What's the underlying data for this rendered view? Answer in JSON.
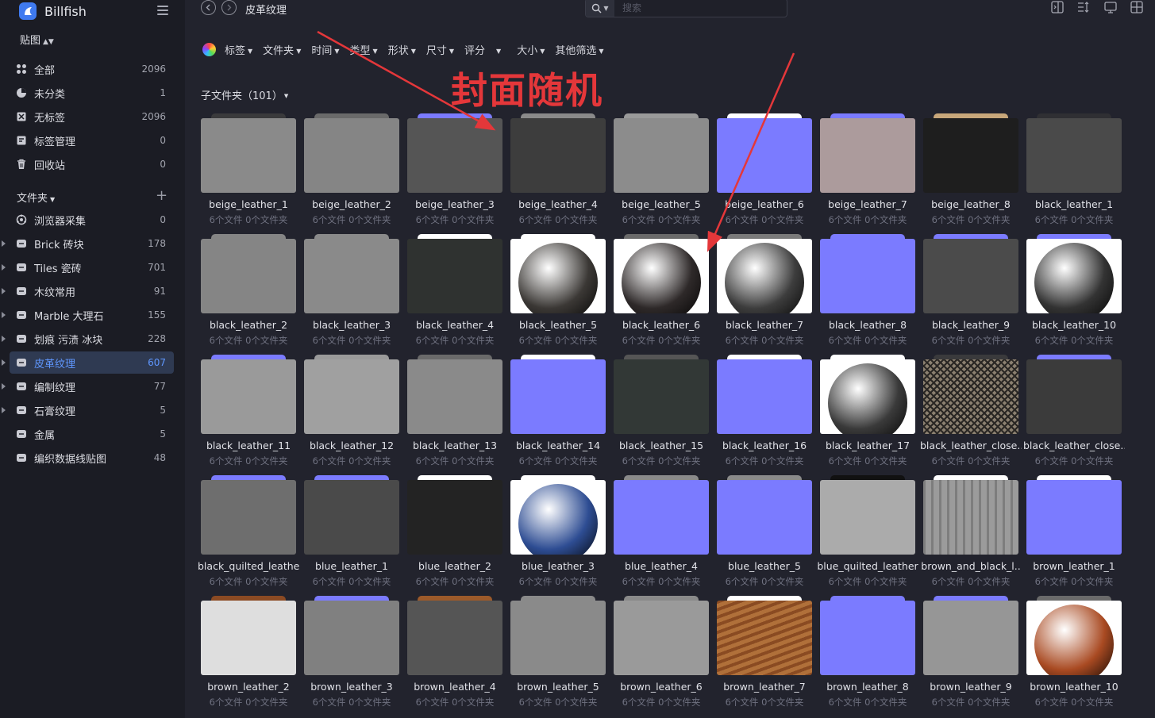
{
  "app": {
    "name": "Billfish",
    "library": "贴图"
  },
  "sidebar": {
    "top_items": [
      {
        "label": "全部",
        "count": "2096",
        "icon": "grid-icon"
      },
      {
        "label": "未分类",
        "count": "1",
        "icon": "pie-icon"
      },
      {
        "label": "无标签",
        "count": "2096",
        "icon": "tag-off-icon"
      },
      {
        "label": "标签管理",
        "count": "0",
        "icon": "tag-manage-icon"
      },
      {
        "label": "回收站",
        "count": "0",
        "icon": "trash-icon"
      }
    ],
    "folders_label": "文件夹",
    "folders": [
      {
        "label": "浏览器采集",
        "count": "0",
        "expandable": false,
        "special": true
      },
      {
        "label": "Brick 砖块",
        "count": "178",
        "expandable": true
      },
      {
        "label": "Tiles 瓷砖",
        "count": "701",
        "expandable": true
      },
      {
        "label": "木纹常用",
        "count": "91",
        "expandable": true
      },
      {
        "label": "Marble 大理石",
        "count": "155",
        "expandable": true
      },
      {
        "label": "划痕 污渍 冰块",
        "count": "228",
        "expandable": true
      },
      {
        "label": "皮革纹理",
        "count": "607",
        "expandable": true,
        "active": true
      },
      {
        "label": "编制纹理",
        "count": "77",
        "expandable": true
      },
      {
        "label": "石膏纹理",
        "count": "5",
        "expandable": true
      },
      {
        "label": "金属",
        "count": "5",
        "expandable": false
      },
      {
        "label": "编织数据线贴图",
        "count": "48",
        "expandable": false
      }
    ]
  },
  "topbar": {
    "breadcrumb": "皮革纹理",
    "search_placeholder": "搜索"
  },
  "filters": [
    "标签",
    "文件夹",
    "时间",
    "类型",
    "形状",
    "尺寸",
    "评分",
    "大小",
    "其他筛选"
  ],
  "subfolders_label": "子文件夹（101）",
  "annotation_text": "封面随机",
  "folder_meta": "6个文件 0个文件夹",
  "colors": {
    "accent": "#5f97ff",
    "folder_purple": "#7b7bff",
    "annotation": "#e4373a"
  },
  "folders_grid": [
    {
      "name": "beige_leather_1",
      "cover": "#8a8a8a",
      "tab": "#3a3a3c"
    },
    {
      "name": "beige_leather_2",
      "cover": "#858585",
      "tab": "#6a6a6a"
    },
    {
      "name": "beige_leather_3",
      "cover": "#555555",
      "tab": "#7b7bff"
    },
    {
      "name": "beige_leather_4",
      "cover": "#3d3d3d",
      "tab": "#8a8a8a"
    },
    {
      "name": "beige_leather_5",
      "cover": "#8c8c8c",
      "tab": "#9a9a9a"
    },
    {
      "name": "beige_leather_6",
      "cover": "#7b7bff",
      "tab": "#ffffff"
    },
    {
      "name": "beige_leather_7",
      "cover": "#ac9b9c",
      "tab": "#7b7bff"
    },
    {
      "name": "beige_leather_8",
      "cover": "#1e1e1e",
      "tab": "#c8a77a"
    },
    {
      "name": "black_leather_1",
      "cover": "#4a4a4a",
      "tab": "#2f2f33"
    },
    {
      "name": "black_leather_2",
      "cover": "#858585",
      "tab": "#858585"
    },
    {
      "name": "black_leather_3",
      "cover": "#8a8a8a",
      "tab": "#8a8a8a"
    },
    {
      "name": "black_leather_4",
      "cover": "#2f3230",
      "tab": "#ffffff"
    },
    {
      "name": "black_leather_5",
      "cover": "#ffffff",
      "tab": "#ffffff",
      "sphere": "#3b3835"
    },
    {
      "name": "black_leather_6",
      "cover": "#ffffff",
      "tab": "#6a6a6a",
      "sphere": "#2e2929"
    },
    {
      "name": "black_leather_7",
      "cover": "#ffffff",
      "tab": "#7a7a7a",
      "sphere": "#3d3d3d"
    },
    {
      "name": "black_leather_8",
      "cover": "#7b7bff",
      "tab": "#7b7bff"
    },
    {
      "name": "black_leather_9",
      "cover": "#4b4b4b",
      "tab": "#7b7bff"
    },
    {
      "name": "black_leather_10",
      "cover": "#ffffff",
      "tab": "#7b7bff",
      "sphere": "#333333"
    },
    {
      "name": "black_leather_11",
      "cover": "#9a9a9a",
      "tab": "#7b7bff"
    },
    {
      "name": "black_leather_12",
      "cover": "#a0a0a0",
      "tab": "#9a9a9a"
    },
    {
      "name": "black_leather_13",
      "cover": "#8a8a8a",
      "tab": "#6a6a6a"
    },
    {
      "name": "black_leather_14",
      "cover": "#7b7bff",
      "tab": "#ffffff"
    },
    {
      "name": "black_leather_15",
      "cover": "#323836",
      "tab": "#555555"
    },
    {
      "name": "black_leather_16",
      "cover": "#7b7bff",
      "tab": "#ffffff"
    },
    {
      "name": "black_leather_17",
      "cover": "#ffffff",
      "tab": "#ffffff",
      "sphere": "#3a3a3a"
    },
    {
      "name": "black_leather_close..",
      "cover": "#6b6358",
      "tab": "#3a3a3c",
      "pattern": "net"
    },
    {
      "name": "black_leather_close..",
      "cover": "#3b3b3b",
      "tab": "#7b7bff"
    },
    {
      "name": "black_quilted_leather",
      "cover": "#6e6e6e",
      "tab": "#7b7bff"
    },
    {
      "name": "blue_leather_1",
      "cover": "#4a4a4a",
      "tab": "#7b7bff"
    },
    {
      "name": "blue_leather_2",
      "cover": "#232323",
      "tab": "#ffffff"
    },
    {
      "name": "blue_leather_3",
      "cover": "#ffffff",
      "tab": "#ffffff",
      "sphere": "#2e4d93"
    },
    {
      "name": "blue_leather_4",
      "cover": "#7b7bff",
      "tab": "#8a8a8a"
    },
    {
      "name": "blue_leather_5",
      "cover": "#7b7bff",
      "tab": "#8a8a8a"
    },
    {
      "name": "blue_quilted_leather",
      "cover": "#ababab",
      "tab": "#111111"
    },
    {
      "name": "brown_and_black_l..",
      "cover": "#8a8a8a",
      "tab": "#ffffff",
      "pattern": "scale"
    },
    {
      "name": "brown_leather_1",
      "cover": "#7b7bff",
      "tab": "#ffffff"
    },
    {
      "name": "brown_leather_2",
      "cover": "#dedede",
      "tab": "#8b4a23"
    },
    {
      "name": "brown_leather_3",
      "cover": "#808080",
      "tab": "#7b7bff"
    },
    {
      "name": "brown_leather_4",
      "cover": "#555555",
      "tab": "#9c5a2a"
    },
    {
      "name": "brown_leather_5",
      "cover": "#8a8a8a",
      "tab": "#8a8a8a"
    },
    {
      "name": "brown_leather_6",
      "cover": "#9a9a9a",
      "tab": "#8a8a8a"
    },
    {
      "name": "brown_leather_7",
      "cover": "#9b5a2b",
      "tab": "#ffffff",
      "pattern": "brown"
    },
    {
      "name": "brown_leather_8",
      "cover": "#7b7bff",
      "tab": "#7b7bff"
    },
    {
      "name": "brown_leather_9",
      "cover": "#969696",
      "tab": "#7b7bff"
    },
    {
      "name": "brown_leather_10",
      "cover": "#ffffff",
      "tab": "#6a6a6a",
      "sphere": "#a94a22"
    }
  ]
}
